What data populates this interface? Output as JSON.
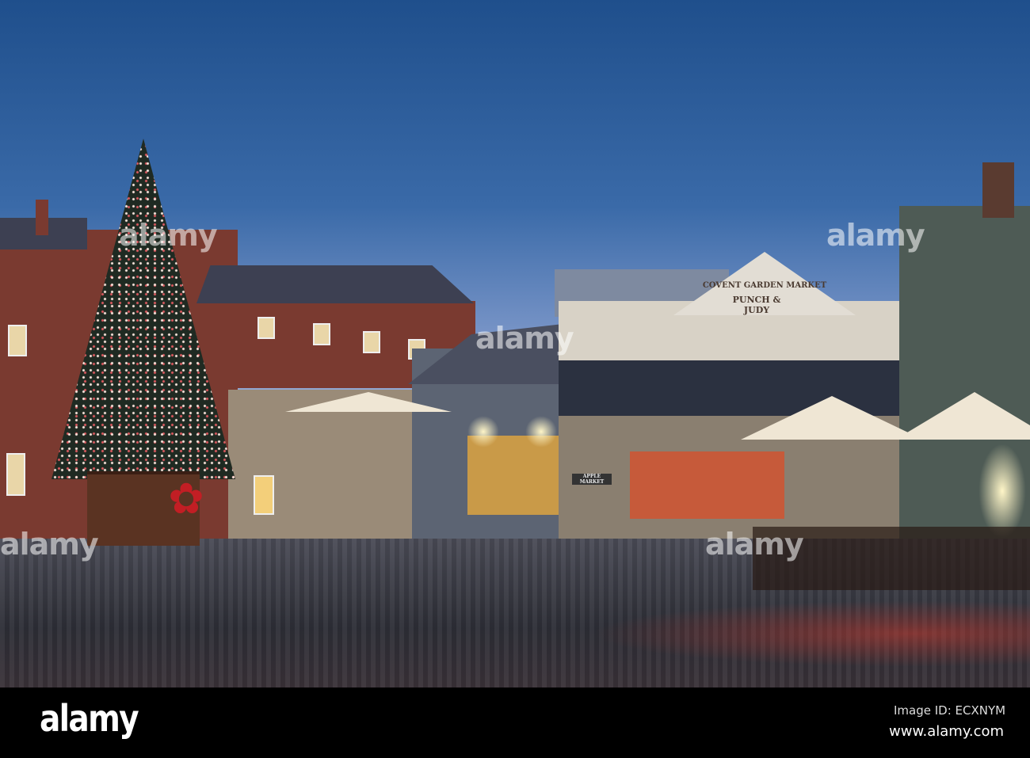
{
  "signage": {
    "market_name": "COVENT GARDEN MARKET",
    "pub_name": "PUNCH & JUDY",
    "shop_sign": "APPLE MARKET"
  },
  "watermark": {
    "text": "alamy"
  },
  "footer": {
    "logo": "alamy",
    "image_id": "Image ID: ECXNYM",
    "url": "www.alamy.com"
  },
  "colors": {
    "sky": "#3a6aa8",
    "brick": "#7a3a30",
    "ribbon": "#c21e24"
  }
}
